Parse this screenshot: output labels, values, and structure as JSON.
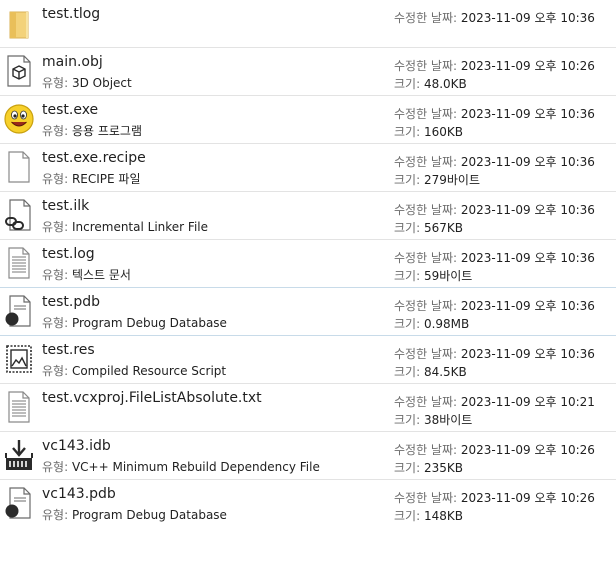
{
  "labels": {
    "type": "유형:",
    "modified": "수정한 날짜:",
    "size": "크기:"
  },
  "files": [
    {
      "name": "test.tlog",
      "icon": "folder-icon",
      "modified": "2023-11-09 오후 10:36"
    },
    {
      "name": "main.obj",
      "icon": "3d-object-icon",
      "type": "3D Object",
      "modified": "2023-11-09 오후 10:26",
      "size": "48.0KB"
    },
    {
      "name": "test.exe",
      "icon": "smiley-exe-icon",
      "type": "응용 프로그램",
      "modified": "2023-11-09 오후 10:36",
      "size": "160KB"
    },
    {
      "name": "test.exe.recipe",
      "icon": "blank-file-icon",
      "type": "RECIPE 파일",
      "modified": "2023-11-09 오후 10:36",
      "size": "279바이트"
    },
    {
      "name": "test.ilk",
      "icon": "linker-file-icon",
      "type": "Incremental Linker File",
      "modified": "2023-11-09 오후 10:36",
      "size": "567KB"
    },
    {
      "name": "test.log",
      "icon": "text-document-icon",
      "type": "텍스트 문서",
      "modified": "2023-11-09 오후 10:36",
      "size": "59바이트"
    },
    {
      "name": "test.pdb",
      "icon": "pdb-file-icon",
      "type": "Program Debug Database",
      "modified": "2023-11-09 오후 10:36",
      "size": "0.98MB"
    },
    {
      "name": "test.res",
      "icon": "resource-script-icon",
      "type": "Compiled Resource Script",
      "modified": "2023-11-09 오후 10:36",
      "size": "84.5KB"
    },
    {
      "name": "test.vcxproj.FileListAbsolute.txt",
      "icon": "text-document-icon",
      "modified": "2023-11-09 오후 10:21",
      "size": "38바이트"
    },
    {
      "name": "vc143.idb",
      "icon": "idb-file-icon",
      "type": "VC++ Minimum Rebuild Dependency File",
      "modified": "2023-11-09 오후 10:26",
      "size": "235KB"
    },
    {
      "name": "vc143.pdb",
      "icon": "pdb-file-icon",
      "type": "Program Debug Database",
      "modified": "2023-11-09 오후 10:26",
      "size": "148KB"
    }
  ]
}
